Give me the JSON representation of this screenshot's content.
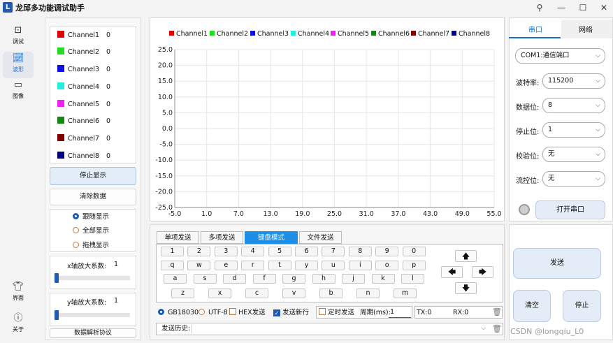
{
  "window": {
    "title": "龙邱多功能调试助手",
    "logo": "L"
  },
  "nav": [
    {
      "label": "调试",
      "icon": "terminal-icon"
    },
    {
      "label": "波形",
      "icon": "waveform-icon"
    },
    {
      "label": "图像",
      "icon": "camera-icon"
    },
    {
      "label": "界面",
      "icon": "shirt-icon"
    },
    {
      "label": "关于",
      "icon": "info-icon"
    }
  ],
  "channels": [
    {
      "name": "Channel1",
      "value": "0",
      "color": "#e00000"
    },
    {
      "name": "Channel2",
      "value": "0",
      "color": "#22dd22"
    },
    {
      "name": "Channel3",
      "value": "0",
      "color": "#1010e0"
    },
    {
      "name": "Channel4",
      "value": "0",
      "color": "#22eedd"
    },
    {
      "name": "Channel5",
      "value": "0",
      "color": "#ee22ee"
    },
    {
      "name": "Channel6",
      "value": "0",
      "color": "#118811"
    },
    {
      "name": "Channel7",
      "value": "0",
      "color": "#800000"
    },
    {
      "name": "Channel8",
      "value": "0",
      "color": "#000080"
    }
  ],
  "left": {
    "stop_display": "停止显示",
    "clear_data": "清除数据",
    "modes": [
      "跟随显示",
      "全部显示",
      "拖拽显示"
    ],
    "mode_selected": 0,
    "x_scale_label": "x轴放大系数:",
    "x_scale_value": "1",
    "x_scale_level": 0,
    "y_scale_label": "y轴放大系数:",
    "y_scale_value": "1",
    "y_scale_level": 0,
    "protocol": "数据解析协议"
  },
  "chart_data": {
    "type": "line",
    "series": [
      {
        "name": "Channel1",
        "values": []
      },
      {
        "name": "Channel2",
        "values": []
      },
      {
        "name": "Channel3",
        "values": []
      },
      {
        "name": "Channel4",
        "values": []
      },
      {
        "name": "Channel5",
        "values": []
      },
      {
        "name": "Channel6",
        "values": []
      },
      {
        "name": "Channel7",
        "values": []
      },
      {
        "name": "Channel8",
        "values": []
      }
    ],
    "x_ticks": [
      "-5.0",
      "1.0",
      "7.0",
      "13.0",
      "19.0",
      "25.0",
      "31.0",
      "37.0",
      "43.0",
      "49.0",
      "55.0"
    ],
    "y_ticks": [
      "25.0",
      "20.0",
      "15.0",
      "10.0",
      "5.0",
      "0.0",
      "-5.0",
      "-10.0",
      "-15.0",
      "-20.0",
      "-25.0"
    ],
    "xlim": [
      -5,
      55
    ],
    "ylim": [
      -25,
      25
    ],
    "grid": true,
    "legend": "top"
  },
  "send": {
    "tabs": [
      "单项发送",
      "多项发送",
      "键盘模式",
      "文件发送"
    ],
    "active_tab": 2,
    "keys_row1": [
      "1",
      "2",
      "3",
      "4",
      "5",
      "6",
      "7",
      "8",
      "9",
      "0"
    ],
    "keys_row2": [
      "q",
      "w",
      "e",
      "r",
      "t",
      "y",
      "u",
      "i",
      "o",
      "p"
    ],
    "keys_row3": [
      "a",
      "s",
      "d",
      "f",
      "g",
      "h",
      "j",
      "k",
      "l"
    ],
    "keys_row4": [
      "z",
      "x",
      "c",
      "v",
      "b",
      "n",
      "m"
    ],
    "arrows": {
      "up": "🡅",
      "left": "🡄",
      "right": "🡆",
      "down": "🡇"
    },
    "encoding_gb": "GB18030",
    "encoding_utf": "UTF-8",
    "hex_send": "HEX发送",
    "newline": "发送新行",
    "timed_send": "定时发送",
    "period_label": "周期(ms):",
    "period_value": "1",
    "tx": "TX:0",
    "rx": "RX:0",
    "history_label": "发送历史:"
  },
  "serial": {
    "tab_serial": "串口",
    "tab_net": "网络",
    "port": "COM1:通信端口",
    "baud_label": "波特率:",
    "baud": "115200",
    "databits_label": "数据位:",
    "databits": "8",
    "stopbits_label": "停止位:",
    "stopbits": "1",
    "parity_label": "校验位:",
    "parity": "无",
    "flow_label": "流控位:",
    "flow": "无",
    "open_port": "打开串口"
  },
  "actions": {
    "send": "发送",
    "clear": "清空",
    "stop": "停止"
  },
  "watermark": "CSDN @longqiu_L0"
}
